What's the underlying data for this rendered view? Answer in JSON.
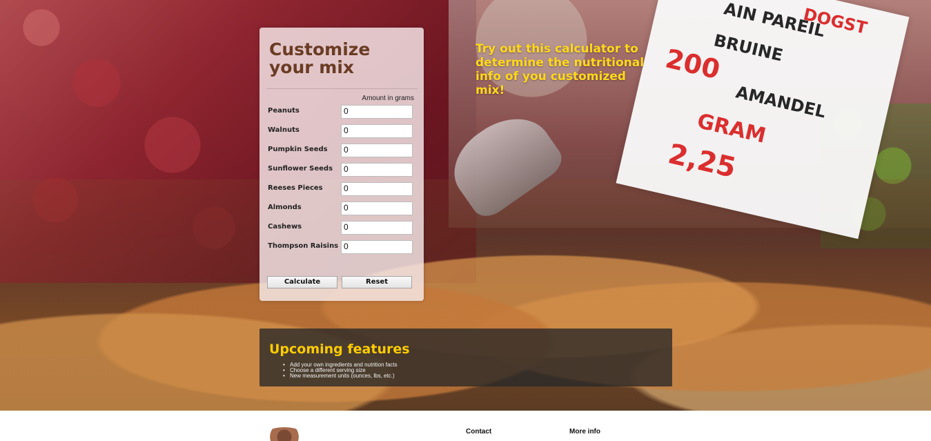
{
  "hero": {
    "sign_lines": [
      "AIN PAREIL",
      "BRUINE",
      "AMANDEL",
      "200",
      "GRAM",
      "2,25",
      "DOGST"
    ]
  },
  "calculator": {
    "title": "Customize your mix",
    "amount_label": "Amount in grams",
    "rows": [
      {
        "label": "Peanuts",
        "value": "0"
      },
      {
        "label": "Walnuts",
        "value": "0"
      },
      {
        "label": "Pumpkin Seeds",
        "value": "0"
      },
      {
        "label": "Sunflower Seeds",
        "value": "0"
      },
      {
        "label": "Reeses Pieces",
        "value": "0"
      },
      {
        "label": "Almonds",
        "value": "0"
      },
      {
        "label": "Cashews",
        "value": "0"
      },
      {
        "label": "Thompson Raisins",
        "value": "0"
      }
    ],
    "buttons": {
      "calculate": "Calculate",
      "reset": "Reset"
    }
  },
  "promo": {
    "text": "Try out this calculator to determine the nutritional info of you customized mix!"
  },
  "upcoming": {
    "title": "Upcoming features",
    "items": [
      "Add your own ingredients and nutrition facts",
      "Choose a different serving size",
      "New measurement units (ounces, lbs, etc.)"
    ]
  },
  "footer": {
    "contact": "Contact",
    "more_info": "More info"
  },
  "colors": {
    "title": "#6a3c24",
    "promo": "#ffd81d",
    "upcoming_title": "#ffcc00"
  }
}
